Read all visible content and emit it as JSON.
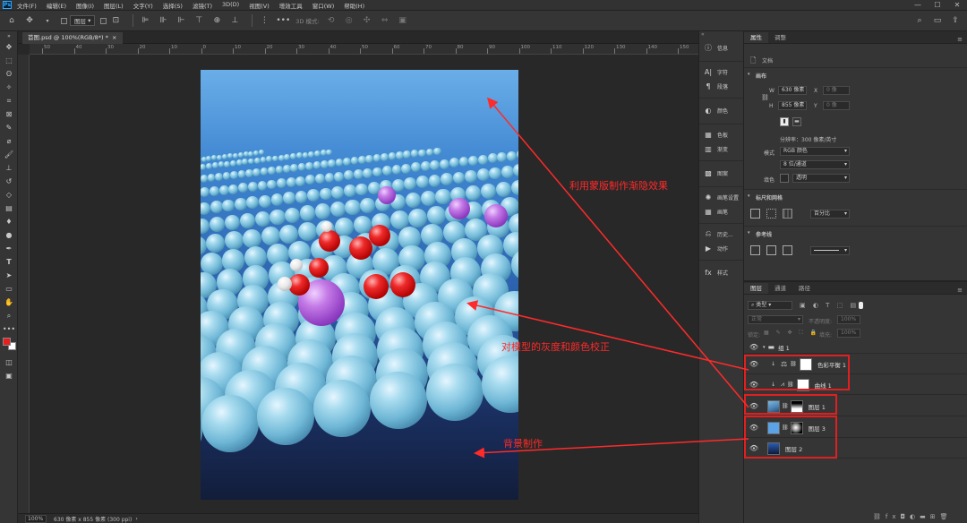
{
  "menubar": {
    "app_icon": "Ps",
    "items": [
      "文件(F)",
      "编辑(E)",
      "图像(I)",
      "图层(L)",
      "文字(Y)",
      "选择(S)",
      "滤镜(T)",
      "3D(D)",
      "视图(V)",
      "增效工具",
      "窗口(W)",
      "帮助(H)"
    ],
    "window_controls": [
      "minimize-icon",
      "maximize-icon",
      "close-icon"
    ]
  },
  "options_bar": {
    "select_value": "图层",
    "mode_3d": "3D 模式:"
  },
  "document": {
    "tab_title": "首图.psd @ 100%(RGB/8*) *",
    "ruler_ticks": [
      "50",
      "40",
      "30",
      "20",
      "10",
      "0",
      "10",
      "20",
      "30",
      "40",
      "50",
      "60",
      "70",
      "80",
      "90",
      "100",
      "110",
      "120",
      "130",
      "140",
      "150"
    ]
  },
  "status_bar": {
    "zoom": "100%",
    "info": "630 像素 x 855 像素 (300 ppi)"
  },
  "dock": {
    "items": [
      {
        "icon": "info-icon",
        "label": "信息"
      },
      {
        "icon": "character-icon",
        "label": "字符"
      },
      {
        "icon": "paragraph-icon",
        "label": "段落"
      },
      {
        "icon": "color-icon",
        "label": "颜色"
      },
      {
        "icon": "swatches-icon",
        "label": "色板"
      },
      {
        "icon": "gradients-icon",
        "label": "渐变"
      },
      {
        "icon": "patterns-icon",
        "label": "图案"
      },
      {
        "icon": "brush-settings-icon",
        "label": "画笔设置"
      },
      {
        "icon": "brushes-icon",
        "label": "画笔"
      },
      {
        "icon": "history-icon",
        "label": "历史..."
      },
      {
        "icon": "actions-icon",
        "label": "动作"
      },
      {
        "icon": "styles-icon",
        "label": "样式"
      }
    ]
  },
  "properties": {
    "tabs": [
      "属性",
      "调整"
    ],
    "doc_label": "文档",
    "canvas_section": "画布",
    "w_label": "W",
    "w_value": "630 像素",
    "x_label": "X",
    "x_value": "0 像",
    "h_label": "H",
    "h_value": "855 像素",
    "y_label": "Y",
    "y_value": "0 像",
    "resolution": "分辨率：300 像素/英寸",
    "mode_label": "模式",
    "mode_value": "RGB 颜色",
    "depth_value": "8 位/通道",
    "fill_label": "填色",
    "fill_value": "透明",
    "rulers_section": "标尺和网格",
    "units_value": "百分比",
    "guides_section": "参考线"
  },
  "layers_panel": {
    "tabs": [
      "图层",
      "通道",
      "路径"
    ],
    "filter_label": "类型",
    "blend_mode": "正常",
    "opacity_label": "不透明度:",
    "opacity_value": "100%",
    "lock_label": "锁定:",
    "fill_label": "填充:",
    "fill_value": "100%",
    "group_name": "组 1",
    "layers": [
      {
        "name": "色彩平衡 1",
        "type": "adjustment"
      },
      {
        "name": "曲线 1",
        "type": "adjustment"
      },
      {
        "name": "图层 1",
        "type": "image"
      },
      {
        "name": "图层 3",
        "type": "image"
      },
      {
        "name": "图层 2",
        "type": "image"
      }
    ]
  },
  "annotations": {
    "top": "利用蒙版制作渐隐效果",
    "middle": "对模型的灰度和颜色校正",
    "bottom": "背景制作"
  },
  "colors": {
    "annotation_red": "#ff2a2a",
    "foreground": "#e81d1d",
    "background": "#ffffff"
  }
}
